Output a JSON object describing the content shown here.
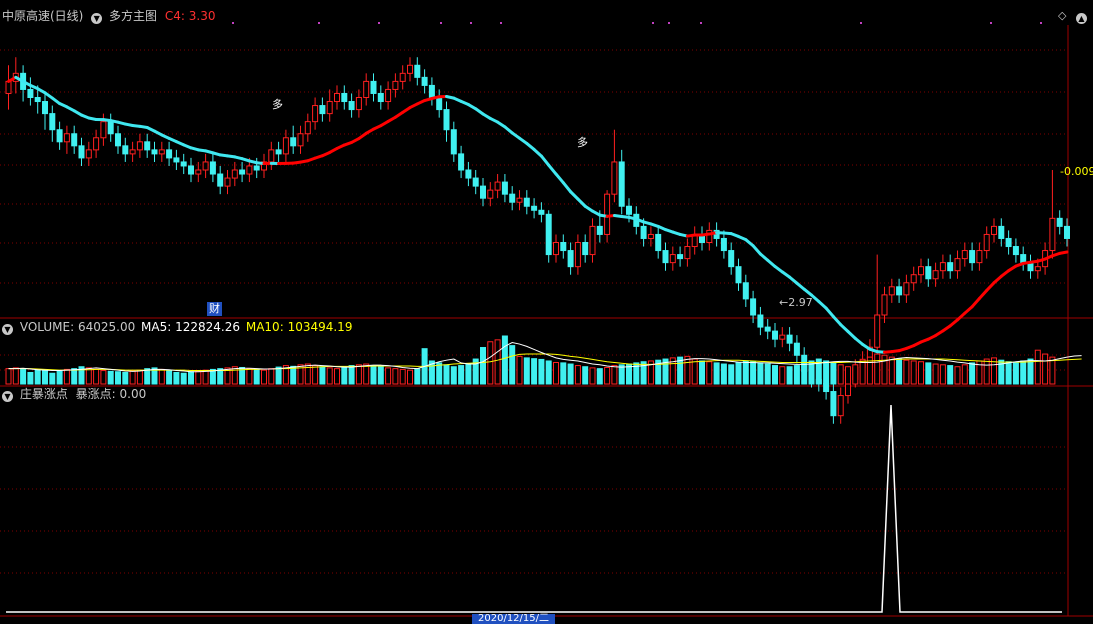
{
  "header": {
    "stock_name": "中原高速(日线)",
    "indicator_name": "多方主图",
    "c4_label": "C4:",
    "c4_value": "3.30"
  },
  "price_panel": {
    "low_label": "2.97",
    "right_value": "-0.009",
    "cai_badge": "财",
    "duo_label_1": "多",
    "duo_label_2": "多"
  },
  "volume_panel": {
    "volume_label": "VOLUME:",
    "volume_value": "64025.00",
    "ma5_label": "MA5:",
    "ma5_value": "122824.26",
    "ma10_label": "MA10:",
    "ma10_value": "103494.19"
  },
  "indicator_panel": {
    "title": "庄暴涨点",
    "value_label": "暴涨点:",
    "value": "0.00"
  },
  "bottom_axis": {
    "highlight_date": "2020/12/15/二"
  },
  "colors": {
    "bull": "#ff2020",
    "bear": "#40f0f0",
    "ma_up": "#ff0000",
    "ma_down": "#40e8f0",
    "grid": "#800000",
    "ma5": "#ffffff",
    "ma10": "#ffff00"
  },
  "chart_data": {
    "type": "candlestick",
    "ylim": [
      2.9,
      3.62
    ],
    "candles": [
      [
        3.45,
        3.48,
        3.52,
        3.41
      ],
      [
        3.48,
        3.5,
        3.54,
        3.45
      ],
      [
        3.5,
        3.46,
        3.52,
        3.43
      ],
      [
        3.46,
        3.44,
        3.49,
        3.42
      ],
      [
        3.44,
        3.43,
        3.47,
        3.4
      ],
      [
        3.43,
        3.4,
        3.45,
        3.36
      ],
      [
        3.4,
        3.36,
        3.42,
        3.33
      ],
      [
        3.36,
        3.33,
        3.38,
        3.31
      ],
      [
        3.33,
        3.35,
        3.37,
        3.3
      ],
      [
        3.35,
        3.32,
        3.37,
        3.3
      ],
      [
        3.32,
        3.29,
        3.34,
        3.27
      ],
      [
        3.29,
        3.31,
        3.33,
        3.27
      ],
      [
        3.31,
        3.34,
        3.36,
        3.29
      ],
      [
        3.34,
        3.38,
        3.4,
        3.32
      ],
      [
        3.38,
        3.35,
        3.4,
        3.33
      ],
      [
        3.35,
        3.32,
        3.37,
        3.3
      ],
      [
        3.32,
        3.3,
        3.34,
        3.28
      ],
      [
        3.3,
        3.31,
        3.33,
        3.28
      ],
      [
        3.31,
        3.33,
        3.35,
        3.29
      ],
      [
        3.33,
        3.31,
        3.35,
        3.29
      ],
      [
        3.31,
        3.3,
        3.33,
        3.28
      ],
      [
        3.3,
        3.31,
        3.33,
        3.28
      ],
      [
        3.31,
        3.29,
        3.33,
        3.27
      ],
      [
        3.29,
        3.28,
        3.31,
        3.26
      ],
      [
        3.28,
        3.27,
        3.3,
        3.25
      ],
      [
        3.27,
        3.25,
        3.29,
        3.23
      ],
      [
        3.25,
        3.26,
        3.28,
        3.23
      ],
      [
        3.26,
        3.28,
        3.3,
        3.24
      ],
      [
        3.28,
        3.25,
        3.3,
        3.23
      ],
      [
        3.25,
        3.22,
        3.27,
        3.2
      ],
      [
        3.22,
        3.24,
        3.26,
        3.2
      ],
      [
        3.24,
        3.26,
        3.28,
        3.22
      ],
      [
        3.26,
        3.25,
        3.28,
        3.23
      ],
      [
        3.25,
        3.27,
        3.29,
        3.23
      ],
      [
        3.27,
        3.26,
        3.29,
        3.24
      ],
      [
        3.26,
        3.28,
        3.3,
        3.24
      ],
      [
        3.28,
        3.31,
        3.33,
        3.26
      ],
      [
        3.31,
        3.3,
        3.33,
        3.28
      ],
      [
        3.3,
        3.34,
        3.36,
        3.28
      ],
      [
        3.34,
        3.32,
        3.37,
        3.3
      ],
      [
        3.32,
        3.35,
        3.37,
        3.3
      ],
      [
        3.35,
        3.38,
        3.4,
        3.33
      ],
      [
        3.38,
        3.42,
        3.44,
        3.36
      ],
      [
        3.42,
        3.4,
        3.44,
        3.38
      ],
      [
        3.4,
        3.43,
        3.46,
        3.38
      ],
      [
        3.43,
        3.45,
        3.47,
        3.41
      ],
      [
        3.45,
        3.43,
        3.47,
        3.41
      ],
      [
        3.43,
        3.41,
        3.45,
        3.39
      ],
      [
        3.41,
        3.44,
        3.46,
        3.39
      ],
      [
        3.44,
        3.48,
        3.5,
        3.42
      ],
      [
        3.48,
        3.45,
        3.5,
        3.43
      ],
      [
        3.45,
        3.43,
        3.47,
        3.41
      ],
      [
        3.43,
        3.46,
        3.48,
        3.41
      ],
      [
        3.46,
        3.48,
        3.5,
        3.44
      ],
      [
        3.48,
        3.5,
        3.52,
        3.46
      ],
      [
        3.5,
        3.52,
        3.54,
        3.48
      ],
      [
        3.52,
        3.49,
        3.54,
        3.47
      ],
      [
        3.49,
        3.47,
        3.51,
        3.45
      ],
      [
        3.47,
        3.44,
        3.49,
        3.42
      ],
      [
        3.44,
        3.41,
        3.46,
        3.39
      ],
      [
        3.41,
        3.36,
        3.43,
        3.33
      ],
      [
        3.36,
        3.3,
        3.38,
        3.28
      ],
      [
        3.3,
        3.26,
        3.32,
        3.24
      ],
      [
        3.26,
        3.24,
        3.28,
        3.22
      ],
      [
        3.24,
        3.22,
        3.26,
        3.2
      ],
      [
        3.22,
        3.19,
        3.24,
        3.17
      ],
      [
        3.19,
        3.21,
        3.23,
        3.17
      ],
      [
        3.21,
        3.23,
        3.25,
        3.19
      ],
      [
        3.23,
        3.2,
        3.25,
        3.18
      ],
      [
        3.2,
        3.18,
        3.22,
        3.16
      ],
      [
        3.18,
        3.19,
        3.21,
        3.16
      ],
      [
        3.19,
        3.17,
        3.21,
        3.15
      ],
      [
        3.17,
        3.16,
        3.19,
        3.14
      ],
      [
        3.16,
        3.15,
        3.18,
        3.13
      ],
      [
        3.15,
        3.05,
        3.16,
        3.03
      ],
      [
        3.05,
        3.08,
        3.1,
        3.03
      ],
      [
        3.08,
        3.06,
        3.1,
        3.04
      ],
      [
        3.06,
        3.02,
        3.08,
        3.0
      ],
      [
        3.02,
        3.08,
        3.1,
        3.0
      ],
      [
        3.08,
        3.05,
        3.1,
        3.03
      ],
      [
        3.05,
        3.12,
        3.14,
        3.03
      ],
      [
        3.12,
        3.1,
        3.16,
        3.08
      ],
      [
        3.1,
        3.2,
        3.21,
        3.08
      ],
      [
        3.2,
        3.28,
        3.36,
        3.18
      ],
      [
        3.28,
        3.17,
        3.31,
        3.15
      ],
      [
        3.17,
        3.15,
        3.19,
        3.13
      ],
      [
        3.15,
        3.12,
        3.17,
        3.1
      ],
      [
        3.12,
        3.09,
        3.14,
        3.07
      ],
      [
        3.09,
        3.1,
        3.12,
        3.07
      ],
      [
        3.1,
        3.06,
        3.12,
        3.04
      ],
      [
        3.06,
        3.03,
        3.08,
        3.01
      ],
      [
        3.03,
        3.05,
        3.07,
        3.01
      ],
      [
        3.05,
        3.04,
        3.07,
        3.02
      ],
      [
        3.04,
        3.07,
        3.09,
        3.02
      ],
      [
        3.07,
        3.1,
        3.12,
        3.05
      ],
      [
        3.1,
        3.08,
        3.12,
        3.06
      ],
      [
        3.08,
        3.11,
        3.13,
        3.06
      ],
      [
        3.11,
        3.09,
        3.13,
        3.07
      ],
      [
        3.09,
        3.06,
        3.11,
        3.04
      ],
      [
        3.06,
        3.02,
        3.08,
        3.0
      ],
      [
        3.02,
        2.98,
        3.04,
        2.96
      ],
      [
        2.98,
        2.94,
        3.0,
        2.92
      ],
      [
        2.94,
        2.9,
        2.96,
        2.88
      ],
      [
        2.9,
        2.87,
        2.92,
        2.85
      ],
      [
        2.87,
        2.86,
        2.89,
        2.84
      ],
      [
        2.86,
        2.84,
        2.88,
        2.82
      ],
      [
        2.84,
        2.85,
        2.87,
        2.82
      ],
      [
        2.85,
        2.83,
        2.87,
        2.81
      ],
      [
        2.83,
        2.8,
        2.85,
        2.78
      ],
      [
        2.8,
        2.76,
        2.82,
        2.74
      ],
      [
        2.76,
        2.74,
        2.78,
        2.72
      ],
      [
        2.74,
        2.73,
        2.76,
        2.71
      ],
      [
        2.73,
        2.71,
        2.75,
        2.69
      ],
      [
        2.71,
        2.65,
        2.73,
        2.63
      ],
      [
        2.65,
        2.7,
        2.72,
        2.63
      ],
      [
        2.7,
        2.74,
        2.76,
        2.68
      ],
      [
        2.74,
        2.77,
        2.79,
        2.72
      ],
      [
        2.77,
        2.79,
        2.81,
        2.75
      ],
      [
        2.79,
        2.82,
        2.84,
        2.77
      ],
      [
        2.82,
        2.9,
        3.05,
        2.8
      ],
      [
        2.9,
        2.95,
        2.97,
        2.88
      ],
      [
        2.95,
        2.97,
        2.99,
        2.93
      ],
      [
        2.97,
        2.95,
        2.99,
        2.93
      ],
      [
        2.95,
        2.98,
        3.0,
        2.93
      ],
      [
        2.98,
        3.0,
        3.02,
        2.96
      ],
      [
        3.0,
        3.02,
        3.04,
        2.98
      ],
      [
        3.02,
        2.99,
        3.04,
        2.97
      ],
      [
        2.99,
        3.01,
        3.03,
        2.97
      ],
      [
        3.01,
        3.03,
        3.05,
        2.99
      ],
      [
        3.03,
        3.01,
        3.05,
        2.99
      ],
      [
        3.01,
        3.04,
        3.06,
        2.99
      ],
      [
        3.04,
        3.06,
        3.08,
        3.02
      ],
      [
        3.06,
        3.03,
        3.08,
        3.01
      ],
      [
        3.03,
        3.06,
        3.08,
        3.01
      ],
      [
        3.06,
        3.1,
        3.12,
        3.04
      ],
      [
        3.1,
        3.12,
        3.14,
        3.08
      ],
      [
        3.12,
        3.09,
        3.14,
        3.07
      ],
      [
        3.09,
        3.07,
        3.11,
        3.05
      ],
      [
        3.07,
        3.05,
        3.09,
        3.03
      ],
      [
        3.05,
        3.03,
        3.07,
        3.01
      ],
      [
        3.03,
        3.01,
        3.05,
        2.99
      ],
      [
        3.01,
        3.02,
        3.04,
        2.99
      ],
      [
        3.02,
        3.06,
        3.08,
        3.0
      ],
      [
        3.06,
        3.14,
        3.26,
        3.04
      ],
      [
        3.14,
        3.12,
        3.16,
        3.1
      ],
      [
        3.12,
        3.09,
        3.14,
        3.07
      ]
    ],
    "volume": [
      40,
      42,
      38,
      30,
      36,
      35,
      28,
      33,
      38,
      40,
      45,
      42,
      38,
      35,
      33,
      32,
      30,
      34,
      36,
      40,
      42,
      38,
      35,
      30,
      28,
      32,
      34,
      36,
      38,
      40,
      42,
      45,
      43,
      40,
      38,
      36,
      40,
      44,
      48,
      46,
      50,
      52,
      48,
      45,
      42,
      40,
      44,
      48,
      50,
      52,
      48,
      45,
      42,
      40,
      38,
      36,
      40,
      92,
      60,
      55,
      50,
      45,
      48,
      52,
      65,
      95,
      110,
      115,
      125,
      100,
      72,
      68,
      66,
      64,
      60,
      56,
      55,
      52,
      48,
      45,
      42,
      40,
      43,
      48,
      50,
      52,
      55,
      58,
      60,
      62,
      65,
      68,
      70,
      72,
      65,
      60,
      58,
      55,
      52,
      50,
      56,
      60,
      58,
      55,
      52,
      48,
      45,
      45,
      48,
      55,
      60,
      65,
      60,
      55,
      50,
      45,
      50,
      60,
      70,
      78,
      75,
      70,
      65,
      62,
      60,
      58,
      55,
      52,
      50,
      48,
      45,
      50,
      55,
      60,
      65,
      68,
      62,
      58,
      56,
      60,
      65,
      88,
      78,
      70
    ],
    "ma5": [
      40,
      40,
      41,
      39,
      37,
      36,
      35,
      35,
      36,
      37,
      38,
      40,
      42,
      40,
      38,
      36,
      34,
      33,
      34,
      36,
      38,
      38,
      37,
      35,
      34,
      32,
      32,
      33,
      34,
      36,
      38,
      40,
      41,
      41,
      40,
      39,
      39,
      40,
      42,
      44,
      46,
      48,
      49,
      48,
      47,
      45,
      44,
      44,
      46,
      48,
      49,
      49,
      48,
      46,
      43,
      41,
      40,
      46,
      52,
      58,
      62,
      65,
      55,
      52,
      52,
      58,
      70,
      84,
      98,
      108,
      104,
      98,
      90,
      82,
      75,
      68,
      64,
      62,
      60,
      56,
      52,
      50,
      47,
      45,
      44,
      45,
      46,
      48,
      50,
      53,
      56,
      58,
      61,
      64,
      66,
      66,
      65,
      63,
      61,
      59,
      57,
      56,
      56,
      55,
      55,
      54,
      53,
      52,
      51,
      51,
      52,
      54,
      56,
      58,
      59,
      59,
      57,
      56,
      56,
      57,
      60,
      64,
      67,
      69,
      68,
      67,
      66,
      64,
      62,
      60,
      57,
      55,
      52,
      50,
      49,
      50,
      52,
      55,
      58,
      60,
      61,
      61,
      60,
      62,
      66,
      70,
      73,
      74
    ],
    "ma10": [
      40,
      40,
      40,
      40,
      39,
      38,
      37,
      36,
      36,
      36,
      37,
      37,
      38,
      38,
      38,
      37,
      36,
      36,
      36,
      36,
      36,
      36,
      36,
      36,
      36,
      35,
      35,
      35,
      35,
      35,
      35,
      36,
      37,
      38,
      38,
      39,
      39,
      40,
      40,
      41,
      42,
      43,
      44,
      45,
      46,
      46,
      46,
      46,
      46,
      46,
      47,
      47,
      47,
      47,
      47,
      47,
      46,
      46,
      47,
      49,
      50,
      52,
      53,
      54,
      55,
      56,
      58,
      62,
      67,
      73,
      77,
      78,
      78,
      78,
      78,
      77,
      75,
      72,
      70,
      67,
      64,
      61,
      58,
      56,
      54,
      52,
      51,
      51,
      51,
      51,
      52,
      53,
      54,
      56,
      58,
      59,
      60,
      61,
      62,
      62,
      62,
      61,
      60,
      59,
      58,
      57,
      56,
      56,
      56,
      56,
      56,
      56,
      56,
      56,
      56,
      57,
      58,
      59,
      60,
      61,
      62,
      63,
      64,
      65,
      65,
      65,
      65,
      65,
      65,
      64,
      63,
      62,
      61,
      60,
      59,
      58,
      57,
      57,
      57,
      57,
      58,
      59,
      60,
      61,
      62,
      63,
      64,
      65
    ]
  }
}
